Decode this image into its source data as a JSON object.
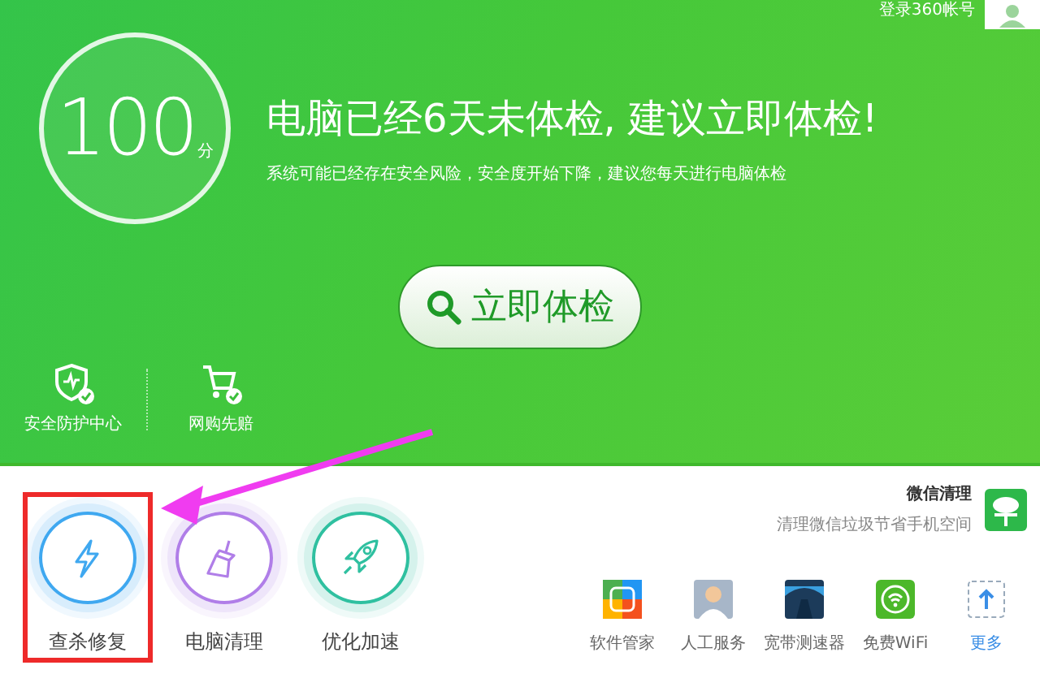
{
  "account": {
    "login": "登录360帐号"
  },
  "score": {
    "value": "100",
    "unit": "分"
  },
  "headline": "电脑已经6天未体检, 建议立即体检!",
  "subtext": "系统可能已经存在安全风险，安全度开始下降，建议您每天进行电脑体检",
  "scan_button": "立即体检",
  "shortcuts": [
    {
      "label": "安全防护中心",
      "kind": "shield"
    },
    {
      "label": "网购先赔",
      "kind": "cart"
    }
  ],
  "promo": {
    "title": "微信清理",
    "subtitle": "清理微信垃圾节省手机空间"
  },
  "tools": [
    {
      "label": "查杀修复",
      "kind": "bolt",
      "color": "#3fa8f0",
      "highlighted": true
    },
    {
      "label": "电脑清理",
      "kind": "broom",
      "color": "#b07ee8",
      "highlighted": false
    },
    {
      "label": "优化加速",
      "kind": "rocket",
      "color": "#2fc0a0",
      "highlighted": false
    }
  ],
  "apps": [
    {
      "label": "软件管家",
      "kind": "apps"
    },
    {
      "label": "人工服务",
      "kind": "agent"
    },
    {
      "label": "宽带测速器",
      "kind": "speed"
    },
    {
      "label": "免费WiFi",
      "kind": "wifi"
    },
    {
      "label": "更多",
      "kind": "more"
    }
  ]
}
